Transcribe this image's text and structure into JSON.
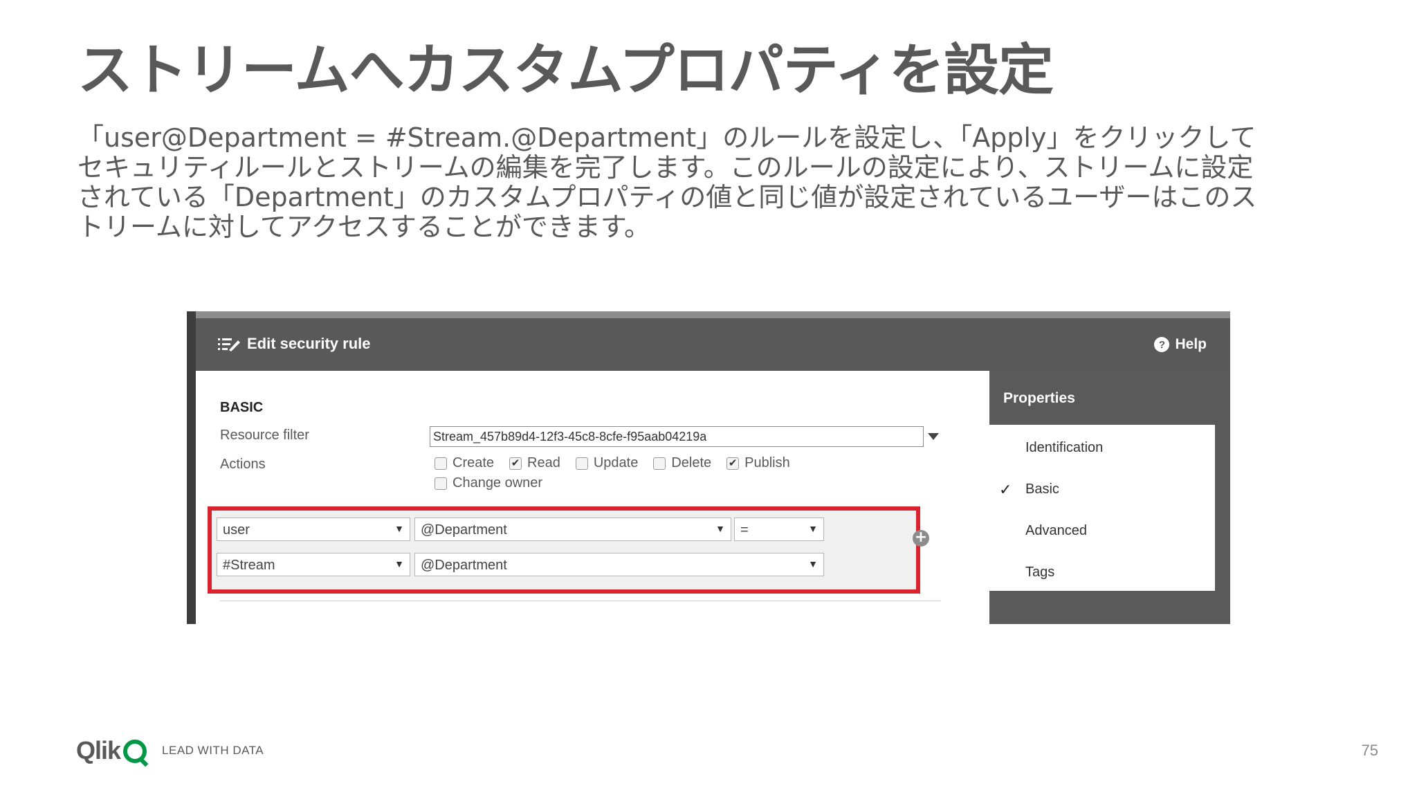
{
  "slide": {
    "title": "ストリームへカスタムプロパティを設定",
    "description_lines": [
      "「user@Department = #Stream.@Department」のルールを設定し、「Apply」をクリックして",
      "セキュリティルールとストリームの編集を完了します。このルールの設定により、ストリームに設定",
      "されている「Department」のカスタムプロパティの値と同じ値が設定されているユーザーはこのス",
      "トリームに対してアクセスすることができます。"
    ],
    "page_number": "75"
  },
  "dialog": {
    "title": "Edit security rule",
    "help_label": "Help",
    "section_heading": "BASIC",
    "resource_filter_label": "Resource filter",
    "resource_filter_value": "Stream_457b89d4-12f3-45c8-8cfe-f95aab04219a",
    "actions_label": "Actions",
    "actions": [
      {
        "label": "Create",
        "checked": false
      },
      {
        "label": "Read",
        "checked": true
      },
      {
        "label": "Update",
        "checked": false
      },
      {
        "label": "Delete",
        "checked": false
      },
      {
        "label": "Publish",
        "checked": true
      },
      {
        "label": "Change owner",
        "checked": false
      }
    ],
    "rule": {
      "row1": {
        "left": "user",
        "middle": "@Department",
        "operator": "="
      },
      "row2": {
        "left": "#Stream",
        "middle": "@Department"
      }
    },
    "highlight_color": "#d9232e"
  },
  "properties": {
    "title": "Properties",
    "items": [
      {
        "label": "Identification",
        "selected": false
      },
      {
        "label": "Basic",
        "selected": true
      },
      {
        "label": "Advanced",
        "selected": false
      },
      {
        "label": "Tags",
        "selected": false
      }
    ]
  },
  "footer": {
    "brand": "Qlik",
    "tagline": "LEAD WITH DATA",
    "brand_color": "#009845"
  },
  "icons": {
    "checked": "✔",
    "dropdown": "▼",
    "plus": "+",
    "check_mark": "✓",
    "help": "?"
  }
}
